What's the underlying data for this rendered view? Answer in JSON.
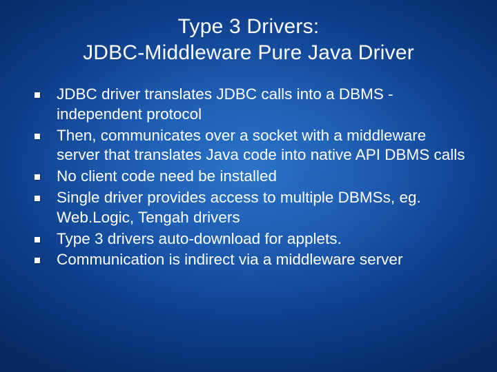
{
  "slide": {
    "title_line1": "Type 3 Drivers:",
    "title_line2": "JDBC-Middleware Pure Java Driver",
    "bullets": [
      "JDBC driver translates JDBC calls into a DBMS -independent protocol",
      "Then, communicates over a socket with a middleware server that translates Java code into native API DBMS calls",
      "No client code need be installed",
      "Single driver provides access to multiple DBMSs, eg. Web.Logic, Tengah drivers",
      "Type 3 drivers auto-download for applets.",
      "Communication is indirect via a middleware server"
    ]
  }
}
